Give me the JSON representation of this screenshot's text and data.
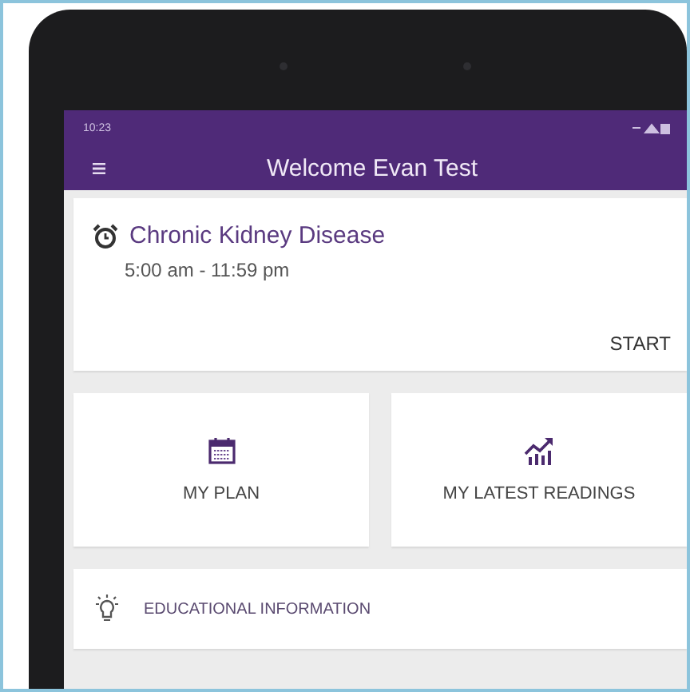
{
  "status_bar": {
    "time": "10:23"
  },
  "app_bar": {
    "title": "Welcome Evan Test"
  },
  "program_card": {
    "title": "Chronic Kidney Disease",
    "time_range": "5:00 am - 11:59 pm",
    "action": "START"
  },
  "tiles": [
    {
      "kind": "calendar",
      "label": "MY PLAN"
    },
    {
      "kind": "chart",
      "label": "MY LATEST READINGS"
    }
  ],
  "info_row": {
    "label": "EDUCATIONAL INFORMATION"
  }
}
